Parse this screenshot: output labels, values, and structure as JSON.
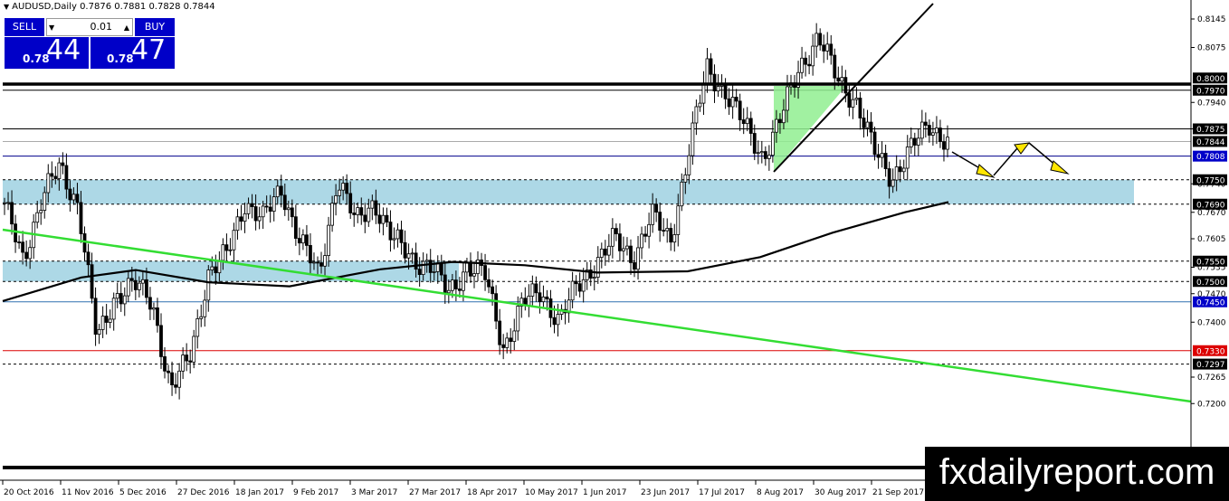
{
  "header": {
    "symbol": "AUDUSD,Daily",
    "open": "0.7876",
    "high": "0.7881",
    "low": "0.7828",
    "close": "0.7844"
  },
  "trade_panel": {
    "sell_label": "SELL",
    "buy_label": "BUY",
    "lot_value": "0.01",
    "sell_price_small": "0.78",
    "sell_price_big": "44",
    "buy_price_small": "0.78",
    "buy_price_big": "47"
  },
  "watermark": "fxdailyreport.com",
  "colors": {
    "zone": "#add8e6",
    "trend_green": "#33dd33",
    "triangle_fill": "#90ee90",
    "resistance": "#000000",
    "support_blue": "#00008b",
    "red_line": "#dc0000",
    "badge_blue": "#0000c8",
    "arrow_yellow": "#ffe600"
  },
  "chart_data": {
    "type": "candlestick",
    "y_range": [
      0.72,
      0.816
    ],
    "price_ticks": [
      "0.8145",
      "0.8075",
      "0.7940",
      "0.7875",
      "0.7740",
      "0.7670",
      "0.7605",
      "0.7535",
      "0.7470",
      "0.7400",
      "0.7265",
      "0.7200"
    ],
    "level_badges": [
      {
        "label": "0.8000",
        "style": "black"
      },
      {
        "label": "0.7970",
        "style": "black"
      },
      {
        "label": "0.7875",
        "style": "black"
      },
      {
        "label": "0.7844",
        "style": "black"
      },
      {
        "label": "0.7808",
        "style": "blue"
      },
      {
        "label": "0.7750",
        "style": "black"
      },
      {
        "label": "0.7690",
        "style": "black"
      },
      {
        "label": "0.7550",
        "style": "black"
      },
      {
        "label": "0.7500",
        "style": "black"
      },
      {
        "label": "0.7450",
        "style": "blue"
      },
      {
        "label": "0.7330",
        "style": "red"
      },
      {
        "label": "0.7297",
        "style": "black"
      }
    ],
    "date_labels": [
      "20 Oct 2016",
      "11 Nov 2016",
      "5 Dec 2016",
      "27 Dec 2016",
      "18 Jan 2017",
      "9 Feb 2017",
      "3 Mar 2017",
      "27 Mar 2017",
      "18 Apr 2017",
      "10 May 2017",
      "1 Jun 2017",
      "23 Jun 2017",
      "17 Jul 2017",
      "8 Aug 2017",
      "30 Aug 2017",
      "21 Sep 2017"
    ],
    "zones": [
      {
        "from": 0.769,
        "to": 0.775
      },
      {
        "from": 0.75,
        "to": 0.755
      }
    ],
    "key_points": [
      0.768,
      0.756,
      0.77,
      0.778,
      0.769,
      0.735,
      0.747,
      0.749,
      0.745,
      0.723,
      0.731,
      0.752,
      0.756,
      0.77,
      0.765,
      0.773,
      0.76,
      0.751,
      0.776,
      0.764,
      0.77,
      0.76,
      0.756,
      0.754,
      0.747,
      0.754,
      0.751,
      0.734,
      0.744,
      0.748,
      0.74,
      0.749,
      0.755,
      0.76,
      0.756,
      0.766,
      0.76,
      0.782,
      0.802,
      0.797,
      0.788,
      0.781,
      0.79,
      0.803,
      0.81,
      0.8,
      0.795,
      0.782,
      0.776,
      0.782,
      0.789,
      0.7844
    ]
  }
}
